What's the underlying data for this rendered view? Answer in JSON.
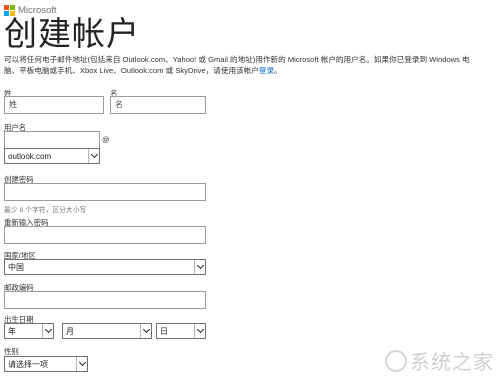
{
  "brand": {
    "name": "Microsoft",
    "colors": [
      "#f25022",
      "#7fba00",
      "#00a4ef",
      "#ffb900"
    ]
  },
  "page": {
    "title": "创建帐户"
  },
  "intro": {
    "line1": "可以将任何电子邮件地址(包括来自 Outlook.com、Yahoo! 或 Gmail 的地址)用作新的 Microsoft 帐户的用户名。如果你已登录到 Windows 电",
    "line2_before": "脑、平板电脑或手机、Xbox Live、Outlook.com 或 SkyDrive，请使用该帐户",
    "link": "登录",
    "line2_after": "。"
  },
  "form": {
    "last_name": {
      "label": "姓",
      "placeholder": "姓"
    },
    "first_name": {
      "label": "名",
      "placeholder": "名"
    },
    "username": {
      "label": "用户名",
      "at": "@",
      "domain": "outlook.com"
    },
    "password": {
      "label": "创建密码",
      "hint": "最少 8 个字符，区分大小写"
    },
    "reenter_password": {
      "label": "重新输入密码"
    },
    "country": {
      "label": "国家/地区",
      "value": "中国"
    },
    "postal_code": {
      "label": "邮政编码"
    },
    "birthdate": {
      "label": "出生日期",
      "year": "年",
      "month": "月",
      "day": "日"
    },
    "gender": {
      "label": "性别",
      "value": "请选择一项"
    }
  },
  "watermark": {
    "text": "系统之家"
  }
}
